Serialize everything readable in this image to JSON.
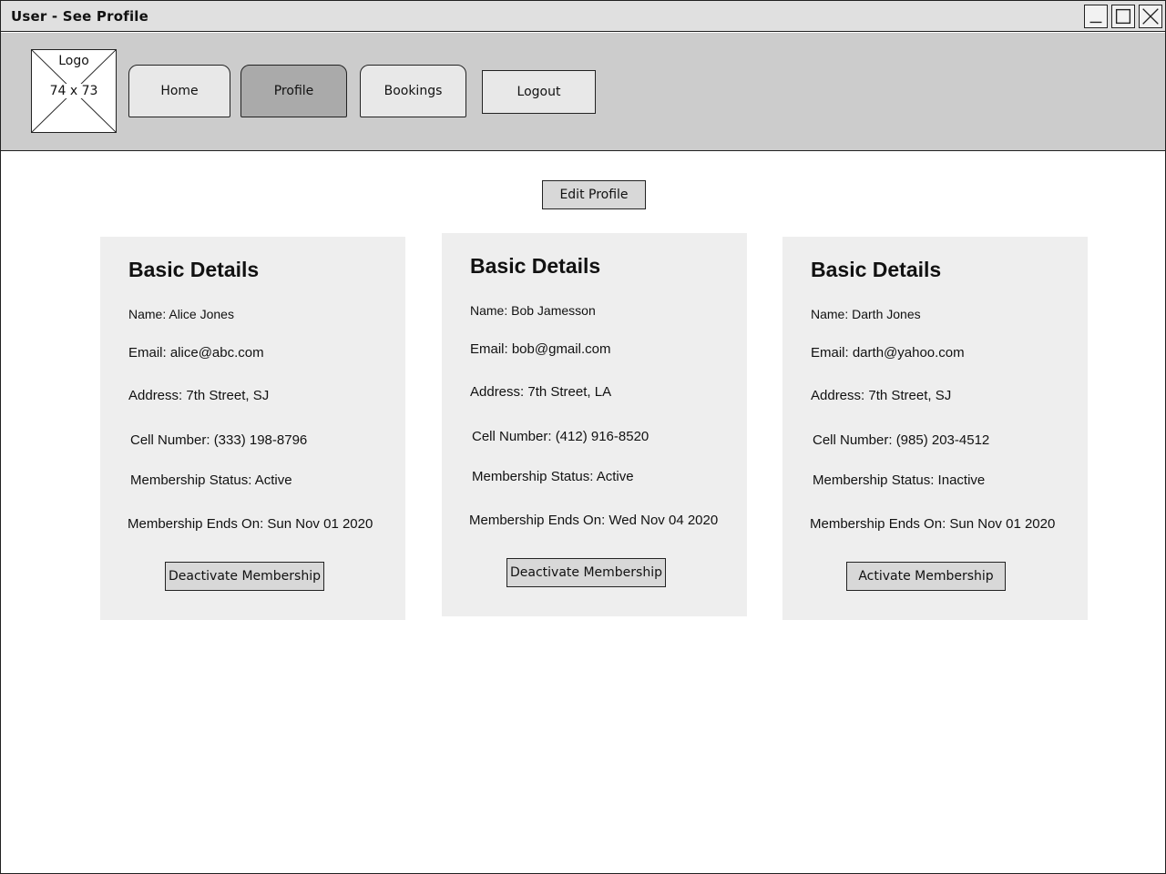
{
  "window": {
    "title": "User - See Profile"
  },
  "logo": {
    "label": "Logo",
    "size_text": "74 x 73"
  },
  "nav": {
    "tabs": [
      {
        "label": "Home",
        "active": false
      },
      {
        "label": "Profile",
        "active": true
      },
      {
        "label": "Bookings",
        "active": false
      }
    ],
    "logout_label": "Logout"
  },
  "edit_profile_label": "Edit Profile",
  "cards": [
    {
      "title": "Basic Details",
      "name": "Name: Alice Jones",
      "email": "Email: alice@abc.com",
      "address": "Address: 7th Street, SJ",
      "cell": "Cell Number: (333) 198-8796",
      "status": "Membership Status: Active",
      "ends": "Membership Ends On: Sun Nov 01 2020",
      "button_label": "Deactivate Membership"
    },
    {
      "title": "Basic Details",
      "name": "Name: Bob Jamesson",
      "email": "Email: bob@gmail.com",
      "address": "Address: 7th Street, LA",
      "cell": "Cell Number: (412) 916-8520",
      "status": "Membership Status: Active",
      "ends": "Membership Ends On: Wed Nov 04 2020",
      "button_label": "Deactivate Membership"
    },
    {
      "title": "Basic Details",
      "name": "Name: Darth Jones",
      "email": "Email: darth@yahoo.com",
      "address": "Address: 7th Street, SJ",
      "cell": "Cell Number: (985) 203-4512",
      "status": "Membership Status: Inactive",
      "ends": "Membership Ends On: Sun Nov 01 2020",
      "button_label": "Activate Membership"
    }
  ],
  "colors": {
    "navbar_bg": "#cccccc",
    "tab_active_bg": "#aaaaaa",
    "card_bg": "#eeeeee",
    "button_bg": "#d8d8d8"
  }
}
